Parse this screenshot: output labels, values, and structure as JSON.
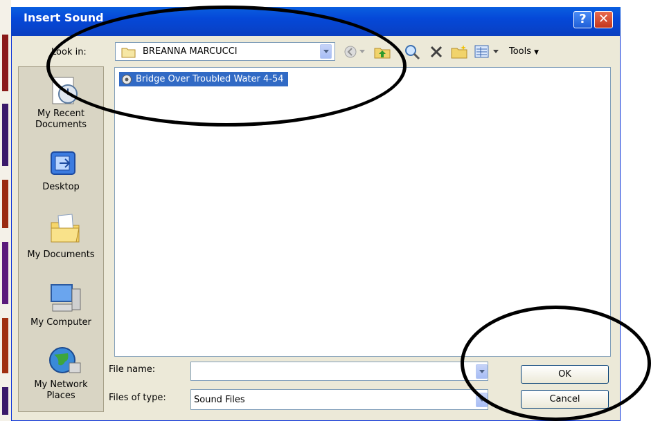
{
  "dialog": {
    "title": "Insert Sound",
    "help_glyph": "?",
    "close_glyph": "✕"
  },
  "look_in": {
    "label": "Look in:",
    "value": "BREANNA MARCUCCI"
  },
  "toolbar": {
    "tools_label": "Tools"
  },
  "places": [
    {
      "label": "My Recent Documents",
      "icon": "recent-documents-icon"
    },
    {
      "label": "Desktop",
      "icon": "desktop-icon"
    },
    {
      "label": "My Documents",
      "icon": "my-documents-icon"
    },
    {
      "label": "My Computer",
      "icon": "my-computer-icon"
    },
    {
      "label": "My Network Places",
      "icon": "network-places-icon"
    }
  ],
  "files": [
    {
      "name": "Bridge Over Troubled Water 4-54",
      "selected": true
    }
  ],
  "file_name": {
    "label": "File name:",
    "value": ""
  },
  "file_type": {
    "label": "Files of type:",
    "value": "Sound Files"
  },
  "buttons": {
    "ok": "OK",
    "cancel": "Cancel"
  },
  "colors": {
    "titlebar": "#0548d8",
    "selection": "#316ac5",
    "dialog_bg": "#ece9d8"
  }
}
